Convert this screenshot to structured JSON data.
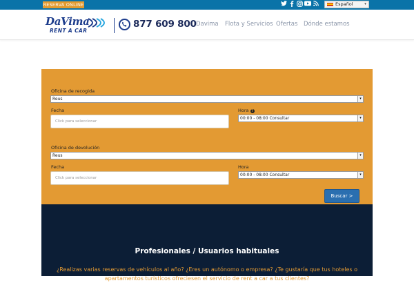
{
  "topbar": {
    "reserva_label": "RESERVA ONLINE",
    "language": "Español",
    "social_icons": [
      "twitter-icon",
      "facebook-icon",
      "instagram-icon",
      "youtube-icon",
      "rss-icon"
    ],
    "color": "#0a73a8"
  },
  "header": {
    "logo_brand": "DaVima",
    "logo_tagline": "RENT A CAR",
    "phone": "877 609 800",
    "nav": [
      "Davima",
      "Flota y Servicios",
      "Ofertas",
      "Dónde estamos"
    ]
  },
  "form": {
    "pickup": {
      "office_label": "Oficina de recogida",
      "office_value": "Reus",
      "date_label": "Fecha",
      "date_placeholder": "Click para seleccionar",
      "time_label": "Hora",
      "time_value": "00:00 - 08:00 Consultar"
    },
    "return": {
      "office_label": "Oficina de devolución",
      "office_value": "Reus",
      "date_label": "Fecha",
      "date_placeholder": "Click para seleccionar",
      "time_label": "Hora",
      "time_value": "00:00 - 08:00 Consultar"
    },
    "search_label": "Buscar >",
    "panel_color": "#e39a33"
  },
  "pro_section": {
    "title": "Profesionales / Usuarios habituales",
    "text": "¿Realizas varias reservas de vehículos al año? ¿Eres un autónomo o empresa? ¿Te gustaría que tus hoteles o apartamentos turísticos ofreciesen el servicio de rent a car a tus clientes?",
    "color": "#0c1e36"
  }
}
